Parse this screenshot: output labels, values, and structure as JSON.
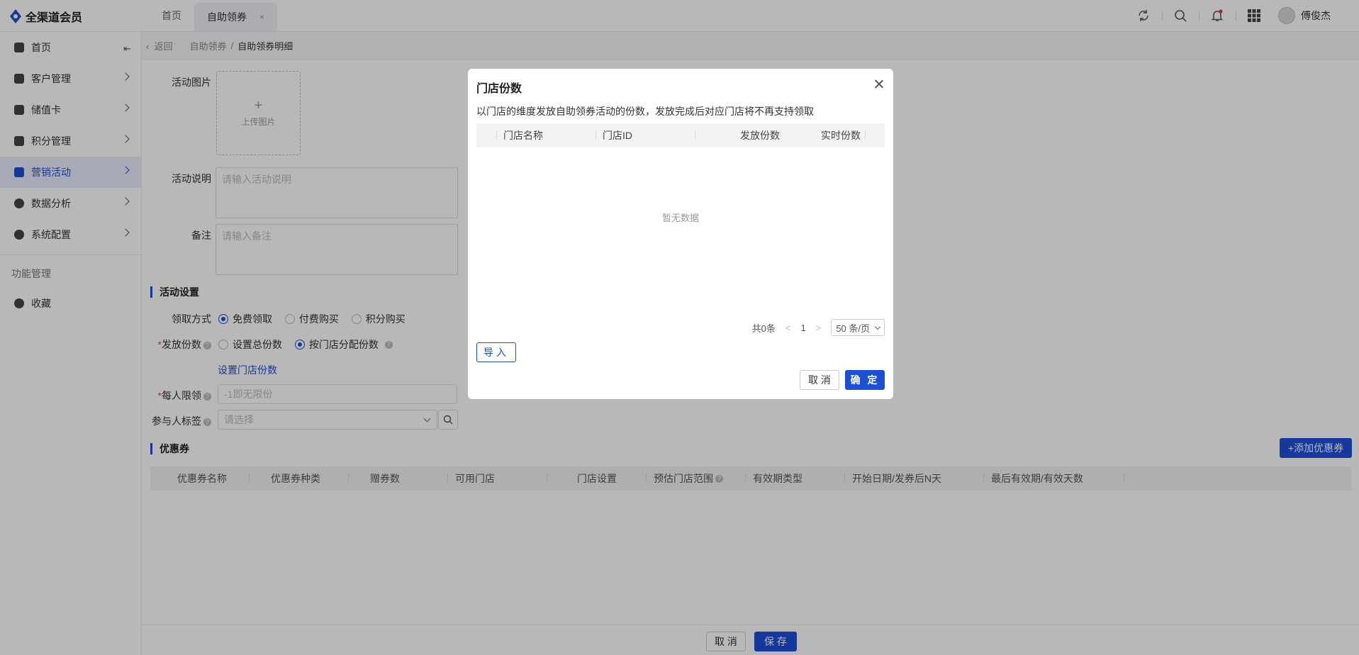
{
  "app": {
    "name": "全渠道会员"
  },
  "tabs": [
    {
      "label": "首页"
    },
    {
      "label": "自助领券",
      "close": "×"
    }
  ],
  "user": {
    "name": "傅俊杰"
  },
  "sidebar": {
    "items": [
      {
        "label": "首页"
      },
      {
        "label": "客户管理"
      },
      {
        "label": "储值卡"
      },
      {
        "label": "积分管理"
      },
      {
        "label": "营销活动"
      },
      {
        "label": "数据分析"
      },
      {
        "label": "系统配置"
      }
    ],
    "group_label": "功能管理",
    "favorites": "收藏"
  },
  "breadcrumb": {
    "back": "返回",
    "parent": "自助领券",
    "current": "自助领券明细"
  },
  "form": {
    "image_label": "活动图片",
    "upload_plus": "+",
    "upload_text": "上传图片",
    "desc_label": "活动说明",
    "desc_placeholder": "请输入活动说明",
    "remark_label": "备注",
    "remark_placeholder": "请输入备注",
    "settings_title": "活动设置",
    "claim_label": "领取方式",
    "claim_options": [
      "免费领取",
      "付费购买",
      "积分购买"
    ],
    "issue_label": "发放份数",
    "issue_options": [
      "设置总份数",
      "按门店分配份数"
    ],
    "set_store_link": "设置门店份数",
    "limit_label": "每人限领",
    "limit_placeholder": "-1即无限份",
    "tag_label": "参与人标签",
    "tag_placeholder": "请选择",
    "coupon_title": "优惠券",
    "add_coupon": "+添加优惠券",
    "coupon_columns": [
      "优惠券名称",
      "优惠券种类",
      "赠券数",
      "可用门店",
      "门店设置",
      "预估门店范围",
      "有效期类型",
      "开始日期/发券后N天",
      "最后有效期/有效天数"
    ],
    "help_mark": "?"
  },
  "footer": {
    "cancel": "取 消",
    "save": "保 存"
  },
  "modal": {
    "title": "门店份数",
    "description": "以门店的维度发放自助领券活动的份数，发放完成后对应门店将不再支持领取",
    "columns": [
      "门店名称",
      "门店ID",
      "发放份数",
      "实时份数"
    ],
    "empty_text": "暂无数据",
    "total": "共0条",
    "prev": "<",
    "page": "1",
    "next": ">",
    "page_size": "50 条/页",
    "import": "导入",
    "cancel": "取 消",
    "ok": "确 定"
  },
  "colors": {
    "primary": "#1d4ed8",
    "required": "#e53935"
  }
}
